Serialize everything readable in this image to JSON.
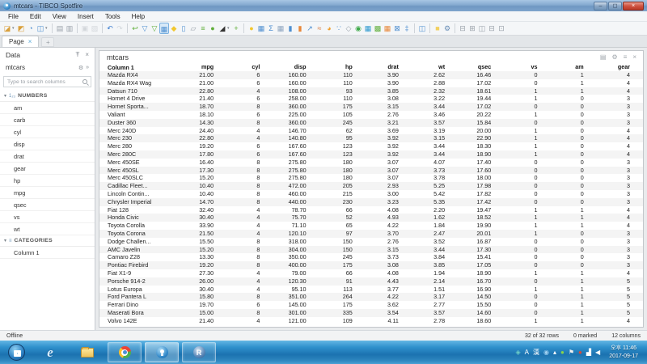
{
  "window": {
    "title": "mtcars - TIBCO Spotfire",
    "minimize_glyph": "–",
    "maximize_glyph": "◻",
    "close_glyph": "×"
  },
  "menu_bar": {
    "items": [
      "File",
      "Edit",
      "View",
      "Insert",
      "Tools",
      "Help"
    ]
  },
  "toolbar": {
    "items": [
      {
        "name": "open",
        "glyph": "◪",
        "color": "#d9a03c",
        "dropdown": true
      },
      {
        "name": "add-data-tables",
        "glyph": "◩",
        "color": "#d9a03c"
      },
      {
        "name": "reload-data",
        "glyph": "◔",
        "color": "#4f8fd0"
      },
      {
        "name": "save",
        "glyph": "◫",
        "color": "#4f8fd0",
        "dropdown": true
      },
      {
        "sep": true
      },
      {
        "name": "print",
        "glyph": "▤",
        "color": "#9aa2aa"
      },
      {
        "name": "export-to-presentation",
        "glyph": "▥",
        "color": "#9aa2aa"
      },
      {
        "sep": true
      },
      {
        "name": "copy",
        "glyph": "▣",
        "color": "#b9bfc5",
        "disabled": true
      },
      {
        "name": "paste",
        "glyph": "▨",
        "color": "#b9bfc5",
        "disabled": true
      },
      {
        "sep": true
      },
      {
        "name": "undo",
        "glyph": "↶",
        "color": "#3f7fd0"
      },
      {
        "name": "redo",
        "glyph": "↷",
        "color": "#b9bfc5",
        "disabled": true
      },
      {
        "sep": true
      },
      {
        "name": "step-back",
        "glyph": "↩",
        "color": "#5fae3a"
      },
      {
        "name": "filters",
        "glyph": "▽",
        "color": "#4f8fd0"
      },
      {
        "name": "filtering-schemes",
        "glyph": "▽",
        "color": "#5fae3a"
      },
      {
        "name": "data-table-view",
        "glyph": "▦",
        "color": "#4f8fd0",
        "selected": true
      },
      {
        "name": "tags",
        "glyph": "◆",
        "color": "#f2c72e"
      },
      {
        "name": "details-on-demand",
        "glyph": "▯",
        "color": "#4f8fd0"
      },
      {
        "name": "data-connections",
        "glyph": "▱",
        "color": "#9aa2aa"
      },
      {
        "name": "axes-settings",
        "glyph": "≡",
        "color": "#5fae3a"
      },
      {
        "name": "comments",
        "glyph": "●",
        "color": "#5fae3a"
      },
      {
        "name": "display-mode",
        "glyph": "◢",
        "color": "#333333",
        "dropdown": true
      },
      {
        "name": "add-visualization",
        "glyph": "+",
        "color": "#5fae3a"
      },
      {
        "sep": true
      },
      {
        "name": "recommendations",
        "glyph": "●",
        "color": "#f2c72e"
      },
      {
        "name": "new-table",
        "glyph": "▦",
        "color": "#4f8fd0"
      },
      {
        "name": "summary-table",
        "glyph": "Σ",
        "color": "#4f8fd0"
      },
      {
        "name": "cross-table",
        "glyph": "▦",
        "color": "#8fa6c0"
      },
      {
        "name": "bar-chart",
        "glyph": "▮",
        "color": "#4f8fd0"
      },
      {
        "name": "stacked-bar-chart",
        "glyph": "▮",
        "color": "#e8883a"
      },
      {
        "name": "line-chart",
        "glyph": "↗",
        "color": "#4f8fd0"
      },
      {
        "name": "combination-chart",
        "glyph": "≈",
        "color": "#d9773a"
      },
      {
        "name": "pie-chart",
        "glyph": "◕",
        "color": "#f0a030"
      },
      {
        "name": "scatter-plot",
        "glyph": "∵",
        "color": "#4f8fd0"
      },
      {
        "name": "3d-scatter-plot",
        "glyph": "◇",
        "color": "#9aa2aa"
      },
      {
        "name": "map-chart",
        "glyph": "◉",
        "color": "#3faa4a"
      },
      {
        "name": "treemap",
        "glyph": "▦",
        "color": "#2e9ad0"
      },
      {
        "name": "heat-map",
        "glyph": "▩",
        "color": "#5fae3a"
      },
      {
        "name": "kpi-chart",
        "glyph": "▦",
        "color": "#e8883a"
      },
      {
        "name": "parallel-coordinate-plot",
        "glyph": "⊠",
        "color": "#4f8fd0"
      },
      {
        "name": "box-plot",
        "glyph": "‡",
        "color": "#4f8fd0"
      },
      {
        "sep": true
      },
      {
        "name": "document-properties",
        "glyph": "◫",
        "color": "#4f8fd0"
      },
      {
        "sep": true
      },
      {
        "name": "bookmarks",
        "glyph": "■",
        "color": "#f2d060"
      },
      {
        "name": "tools-options",
        "glyph": "⚙",
        "color": "#6a8fb8"
      },
      {
        "sep": true
      },
      {
        "name": "panel-layout-left",
        "glyph": "⊟",
        "color": "#9aa2aa"
      },
      {
        "name": "panel-layout-grid",
        "glyph": "⊞",
        "color": "#9aa2aa"
      },
      {
        "name": "panel-layout-columns",
        "glyph": "◫",
        "color": "#9aa2aa"
      },
      {
        "name": "panel-layout-rows",
        "glyph": "⊟",
        "color": "#9aa2aa"
      },
      {
        "name": "maximize-visualization",
        "glyph": "⊡",
        "color": "#9aa2aa"
      }
    ]
  },
  "page_tabs": {
    "active_label": "Page",
    "close_glyph": "×",
    "add_glyph": "+"
  },
  "sidebar": {
    "title": "Data",
    "pin_glyph": "Ŧ",
    "close_glyph": "×",
    "dataset_name": "mtcars",
    "gear_glyph": "⚙",
    "expand_glyph": "»",
    "search_placeholder": "Type to search columns",
    "caret_glyph": "▾",
    "sections": [
      {
        "label": "NUMBERS",
        "icon": "numbers-type-icon",
        "icon_glyph": "1₂₃",
        "items": [
          "am",
          "carb",
          "cyl",
          "disp",
          "drat",
          "gear",
          "hp",
          "mpg",
          "qsec",
          "vs",
          "wt"
        ]
      },
      {
        "label": "CATEGORIES",
        "icon": "categories-type-icon",
        "icon_glyph": "≡",
        "items": [
          "Column 1"
        ]
      }
    ]
  },
  "visualization": {
    "title": "mtcars",
    "icons": [
      {
        "name": "filter-indicator",
        "glyph": "▤"
      },
      {
        "name": "settings-gear",
        "glyph": "⚙"
      },
      {
        "name": "properties-list",
        "glyph": "≡"
      },
      {
        "name": "close",
        "glyph": "×"
      }
    ],
    "table": {
      "columns": [
        "Column 1",
        "mpg",
        "cyl",
        "disp",
        "hp",
        "drat",
        "wt",
        "qsec",
        "vs",
        "am",
        "gear"
      ],
      "rows": [
        [
          "Mazda RX4",
          "21.00",
          "6",
          "160.00",
          "110",
          "3.90",
          "2.62",
          "16.46",
          "0",
          "1",
          "4"
        ],
        [
          "Mazda RX4 Wag",
          "21.00",
          "6",
          "160.00",
          "110",
          "3.90",
          "2.88",
          "17.02",
          "0",
          "1",
          "4"
        ],
        [
          "Datsun 710",
          "22.80",
          "4",
          "108.00",
          "93",
          "3.85",
          "2.32",
          "18.61",
          "1",
          "1",
          "4"
        ],
        [
          "Hornet 4 Drive",
          "21.40",
          "6",
          "258.00",
          "110",
          "3.08",
          "3.22",
          "19.44",
          "1",
          "0",
          "3"
        ],
        [
          "Hornet Sporta...",
          "18.70",
          "8",
          "360.00",
          "175",
          "3.15",
          "3.44",
          "17.02",
          "0",
          "0",
          "3"
        ],
        [
          "Valiant",
          "18.10",
          "6",
          "225.00",
          "105",
          "2.76",
          "3.46",
          "20.22",
          "1",
          "0",
          "3"
        ],
        [
          "Duster 360",
          "14.30",
          "8",
          "360.00",
          "245",
          "3.21",
          "3.57",
          "15.84",
          "0",
          "0",
          "3"
        ],
        [
          "Merc 240D",
          "24.40",
          "4",
          "146.70",
          "62",
          "3.69",
          "3.19",
          "20.00",
          "1",
          "0",
          "4"
        ],
        [
          "Merc 230",
          "22.80",
          "4",
          "140.80",
          "95",
          "3.92",
          "3.15",
          "22.90",
          "1",
          "0",
          "4"
        ],
        [
          "Merc 280",
          "19.20",
          "6",
          "167.60",
          "123",
          "3.92",
          "3.44",
          "18.30",
          "1",
          "0",
          "4"
        ],
        [
          "Merc 280C",
          "17.80",
          "6",
          "167.60",
          "123",
          "3.92",
          "3.44",
          "18.90",
          "1",
          "0",
          "4"
        ],
        [
          "Merc 450SE",
          "16.40",
          "8",
          "275.80",
          "180",
          "3.07",
          "4.07",
          "17.40",
          "0",
          "0",
          "3"
        ],
        [
          "Merc 450SL",
          "17.30",
          "8",
          "275.80",
          "180",
          "3.07",
          "3.73",
          "17.60",
          "0",
          "0",
          "3"
        ],
        [
          "Merc 450SLC",
          "15.20",
          "8",
          "275.80",
          "180",
          "3.07",
          "3.78",
          "18.00",
          "0",
          "0",
          "3"
        ],
        [
          "Cadillac Fleet...",
          "10.40",
          "8",
          "472.00",
          "205",
          "2.93",
          "5.25",
          "17.98",
          "0",
          "0",
          "3"
        ],
        [
          "Lincoln Contin...",
          "10.40",
          "8",
          "460.00",
          "215",
          "3.00",
          "5.42",
          "17.82",
          "0",
          "0",
          "3"
        ],
        [
          "Chrysler Imperial",
          "14.70",
          "8",
          "440.00",
          "230",
          "3.23",
          "5.35",
          "17.42",
          "0",
          "0",
          "3"
        ],
        [
          "Fiat 128",
          "32.40",
          "4",
          "78.70",
          "66",
          "4.08",
          "2.20",
          "19.47",
          "1",
          "1",
          "4"
        ],
        [
          "Honda Civic",
          "30.40",
          "4",
          "75.70",
          "52",
          "4.93",
          "1.62",
          "18.52",
          "1",
          "1",
          "4"
        ],
        [
          "Toyota Corolla",
          "33.90",
          "4",
          "71.10",
          "65",
          "4.22",
          "1.84",
          "19.90",
          "1",
          "1",
          "4"
        ],
        [
          "Toyota Corona",
          "21.50",
          "4",
          "120.10",
          "97",
          "3.70",
          "2.47",
          "20.01",
          "1",
          "0",
          "3"
        ],
        [
          "Dodge Challen...",
          "15.50",
          "8",
          "318.00",
          "150",
          "2.76",
          "3.52",
          "16.87",
          "0",
          "0",
          "3"
        ],
        [
          "AMC Javelin",
          "15.20",
          "8",
          "304.00",
          "150",
          "3.15",
          "3.44",
          "17.30",
          "0",
          "0",
          "3"
        ],
        [
          "Camaro Z28",
          "13.30",
          "8",
          "350.00",
          "245",
          "3.73",
          "3.84",
          "15.41",
          "0",
          "0",
          "3"
        ],
        [
          "Pontiac Firebird",
          "19.20",
          "8",
          "400.00",
          "175",
          "3.08",
          "3.85",
          "17.05",
          "0",
          "0",
          "3"
        ],
        [
          "Fiat X1-9",
          "27.30",
          "4",
          "79.00",
          "66",
          "4.08",
          "1.94",
          "18.90",
          "1",
          "1",
          "4"
        ],
        [
          "Porsche 914-2",
          "26.00",
          "4",
          "120.30",
          "91",
          "4.43",
          "2.14",
          "16.70",
          "0",
          "1",
          "5"
        ],
        [
          "Lotus Europa",
          "30.40",
          "4",
          "95.10",
          "113",
          "3.77",
          "1.51",
          "16.90",
          "1",
          "1",
          "5"
        ],
        [
          "Ford Pantera L",
          "15.80",
          "8",
          "351.00",
          "264",
          "4.22",
          "3.17",
          "14.50",
          "0",
          "1",
          "5"
        ],
        [
          "Ferrari Dino",
          "19.70",
          "6",
          "145.00",
          "175",
          "3.62",
          "2.77",
          "15.50",
          "0",
          "1",
          "5"
        ],
        [
          "Maserati Bora",
          "15.00",
          "8",
          "301.00",
          "335",
          "3.54",
          "3.57",
          "14.60",
          "0",
          "1",
          "5"
        ],
        [
          "Volvo 142E",
          "21.40",
          "4",
          "121.00",
          "109",
          "4.11",
          "2.78",
          "18.60",
          "1",
          "1",
          "4"
        ]
      ]
    }
  },
  "status_bar": {
    "left": "Offline",
    "rows_info": "32 of 32 rows",
    "marked_info": "0 marked",
    "columns_info": "12 columns"
  },
  "taskbar": {
    "apps": [
      {
        "name": "start"
      },
      {
        "name": "internet-explorer"
      },
      {
        "name": "file-explorer"
      },
      {
        "name": "chrome",
        "open": true
      },
      {
        "name": "spotfire",
        "open": true,
        "active": true
      },
      {
        "name": "r-project",
        "open": true
      }
    ],
    "tray": [
      {
        "name": "input-language",
        "glyph": "◈",
        "color": "#6fd0c8"
      },
      {
        "name": "korean-ime",
        "glyph": "A",
        "color": "#ffffff"
      },
      {
        "name": "hanja-key",
        "glyph": "漢",
        "color": "#ffffff"
      },
      {
        "name": "ime-mode",
        "glyph": "◉",
        "color": "#9fd0f0"
      },
      {
        "name": "show-hidden-icons",
        "glyph": "▴",
        "color": "#ffffff"
      },
      {
        "name": "safely-remove-hardware",
        "glyph": "●",
        "color": "#8ad44a"
      },
      {
        "name": "action-center-flag",
        "glyph": "⚑",
        "color": "#f0f0f0"
      },
      {
        "name": "security-alert",
        "glyph": "●",
        "color": "#d84a3a"
      },
      {
        "name": "network",
        "glyph": "▟",
        "color": "#ffffff"
      },
      {
        "name": "volume-muted",
        "glyph": "◀",
        "color": "#ffffff"
      }
    ],
    "clock": {
      "time": "오후 11:46",
      "date": "2017-09-17"
    }
  }
}
